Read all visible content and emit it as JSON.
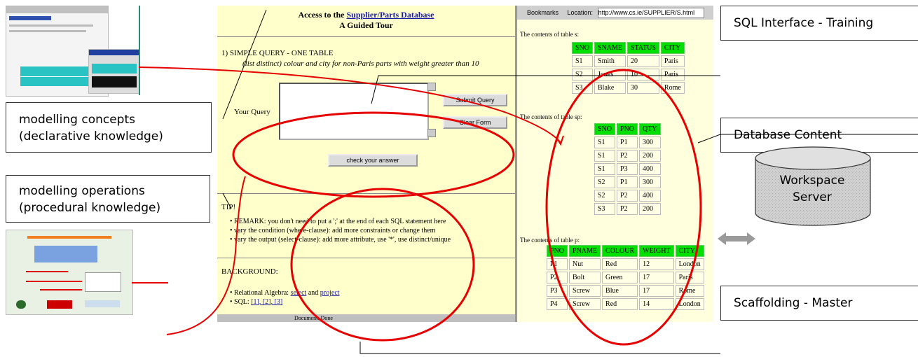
{
  "callouts": {
    "sql_interface": "SQL Interface - Training",
    "modelling_concepts_line1": "modelling concepts",
    "modelling_concepts_line2": "(declarative knowledge)",
    "modelling_operations_line1": "modelling operations",
    "modelling_operations_line2": "(procedural knowledge)",
    "database_content": "Database Content",
    "scaffolding": "Scaffolding - Master"
  },
  "server": {
    "line1": "Workspace",
    "line2": "Server"
  },
  "colors": {
    "annotation_red": "#e60000",
    "table_header_green": "#00e000",
    "page_yellow": "#ffffcc"
  },
  "browser": {
    "title_prefix": "Access to the ",
    "title_link": "Supplier/Parts Database",
    "title_line2": "A Guided Tour",
    "query_heading": "1) SIMPLE QUERY - ONE TABLE",
    "query_task": "(list distinct) colour and city for non-Paris parts with weight greater than 10",
    "your_query_label": "Your Query",
    "submit_button": "Submit Query",
    "clear_button": "Clear Form",
    "check_button": "check your answer",
    "tips_heading": "TIP!",
    "tips": [
      "REMARK: you don't need to put a ';' at the end of each SQL statement here",
      "vary the condition (where-clause): add more constraints or change them",
      "vary the output (select-clause): add more attribute, use '*', use distinct/unique"
    ],
    "background_heading": "BACKGROUND:",
    "background_1_prefix": "Relational Algebra: ",
    "background_1_link1": "select",
    "background_1_mid": " and ",
    "background_1_link2": "project",
    "background_2_prefix": "SQL: ",
    "background_2_links": "[1], [2], [3]",
    "status_text": "Document: Done",
    "toolbar_bookmarks": "Bookmarks",
    "toolbar_location": "Location:",
    "toolbar_url": "http://www.cs.ie/SUPPLIER/S.html"
  },
  "tables": {
    "s": {
      "caption": "The contents of table s:",
      "headers": [
        "SNO",
        "SNAME",
        "STATUS",
        "CITY"
      ],
      "rows": [
        [
          "S1",
          "Smith",
          "20",
          "Paris"
        ],
        [
          "S2",
          "Jones",
          "10",
          "Paris"
        ],
        [
          "S3",
          "Blake",
          "30",
          "Rome"
        ]
      ]
    },
    "sp": {
      "caption": "The contents of table sp:",
      "headers": [
        "SNO",
        "PNO",
        "QTY"
      ],
      "rows": [
        [
          "S1",
          "P1",
          "300"
        ],
        [
          "S1",
          "P2",
          "200"
        ],
        [
          "S1",
          "P3",
          "400"
        ],
        [
          "S2",
          "P1",
          "300"
        ],
        [
          "S2",
          "P2",
          "400"
        ],
        [
          "S3",
          "P2",
          "200"
        ]
      ]
    },
    "p": {
      "caption": "The contents of table p:",
      "headers": [
        "PNO",
        "PNAME",
        "COLOUR",
        "WEIGHT",
        "CITY"
      ],
      "rows": [
        [
          "P1",
          "Nut",
          "Red",
          "12",
          "London"
        ],
        [
          "P2",
          "Bolt",
          "Green",
          "17",
          "Paris"
        ],
        [
          "P3",
          "Screw",
          "Blue",
          "17",
          "Rome"
        ],
        [
          "P4",
          "Screw",
          "Red",
          "14",
          "London"
        ]
      ]
    }
  }
}
